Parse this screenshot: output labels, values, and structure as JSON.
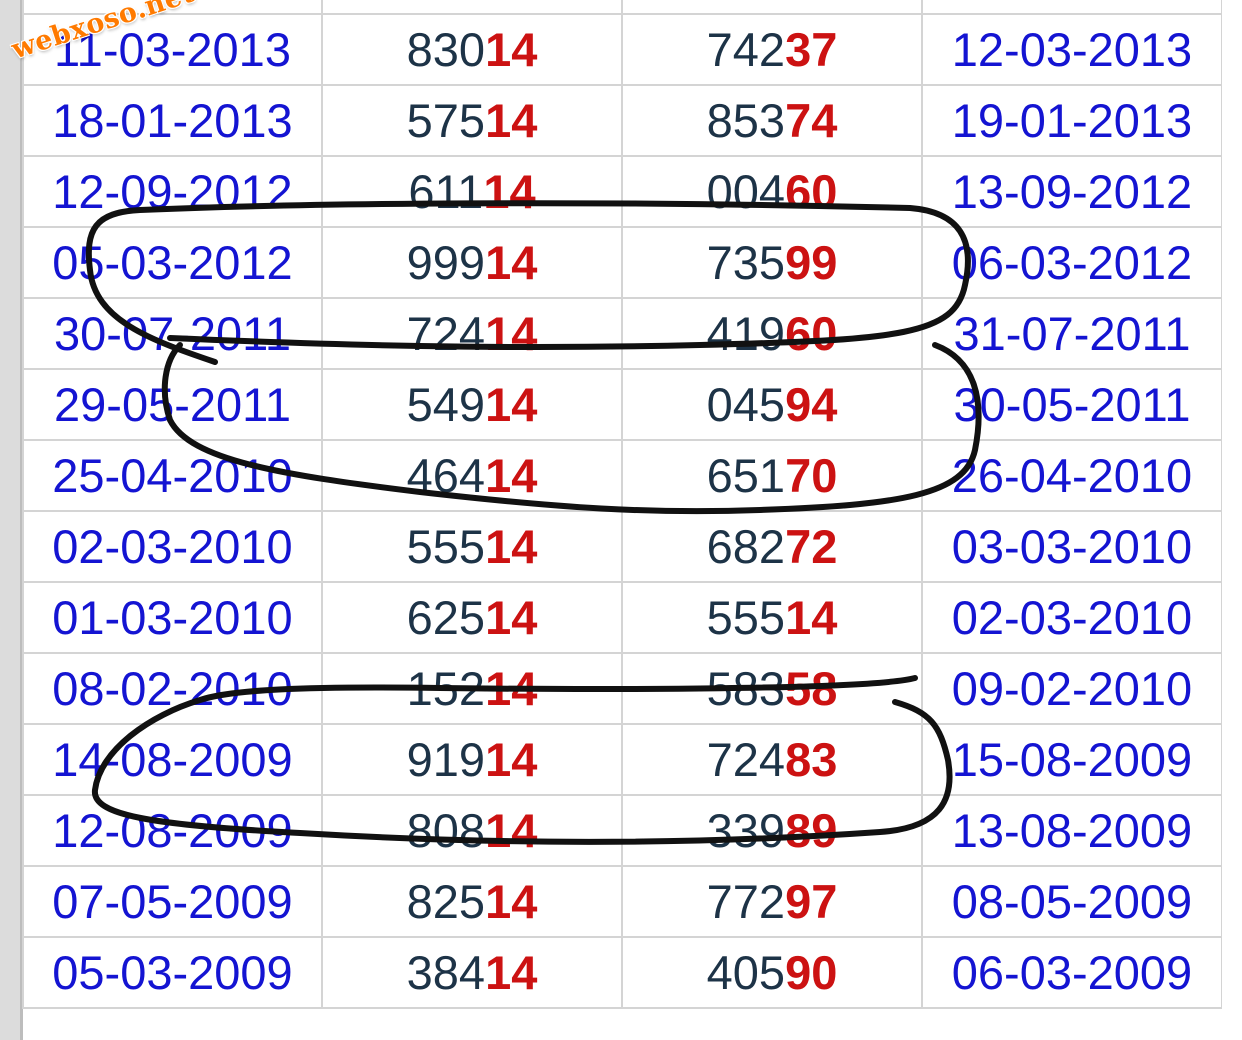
{
  "watermark": "webxoso.net",
  "rows": [
    {
      "date": "11-03-2013",
      "num1_head": "830",
      "num1_tail": "14",
      "num2_head": "742",
      "num2_tail": "37",
      "date2": "12-03-2013"
    },
    {
      "date": "18-01-2013",
      "num1_head": "575",
      "num1_tail": "14",
      "num2_head": "853",
      "num2_tail": "74",
      "date2": "19-01-2013"
    },
    {
      "date": "12-09-2012",
      "num1_head": "611",
      "num1_tail": "14",
      "num2_head": "004",
      "num2_tail": "60",
      "date2": "13-09-2012"
    },
    {
      "date": "05-03-2012",
      "num1_head": "999",
      "num1_tail": "14",
      "num2_head": "735",
      "num2_tail": "99",
      "date2": "06-03-2012"
    },
    {
      "date": "30-07-2011",
      "num1_head": "724",
      "num1_tail": "14",
      "num2_head": "419",
      "num2_tail": "60",
      "date2": "31-07-2011"
    },
    {
      "date": "29-05-2011",
      "num1_head": "549",
      "num1_tail": "14",
      "num2_head": "045",
      "num2_tail": "94",
      "date2": "30-05-2011"
    },
    {
      "date": "25-04-2010",
      "num1_head": "464",
      "num1_tail": "14",
      "num2_head": "651",
      "num2_tail": "70",
      "date2": "26-04-2010"
    },
    {
      "date": "02-03-2010",
      "num1_head": "555",
      "num1_tail": "14",
      "num2_head": "682",
      "num2_tail": "72",
      "date2": "03-03-2010"
    },
    {
      "date": "01-03-2010",
      "num1_head": "625",
      "num1_tail": "14",
      "num2_head": "555",
      "num2_tail": "14",
      "date2": "02-03-2010"
    },
    {
      "date": "08-02-2010",
      "num1_head": "152",
      "num1_tail": "14",
      "num2_head": "583",
      "num2_tail": "58",
      "date2": "09-02-2010"
    },
    {
      "date": "14-08-2009",
      "num1_head": "919",
      "num1_tail": "14",
      "num2_head": "724",
      "num2_tail": "83",
      "date2": "15-08-2009"
    },
    {
      "date": "12-08-2009",
      "num1_head": "808",
      "num1_tail": "14",
      "num2_head": "339",
      "num2_tail": "89",
      "date2": "13-08-2009"
    },
    {
      "date": "07-05-2009",
      "num1_head": "825",
      "num1_tail": "14",
      "num2_head": "772",
      "num2_tail": "97",
      "date2": "08-05-2009"
    },
    {
      "date": "05-03-2009",
      "num1_head": "384",
      "num1_tail": "14",
      "num2_head": "405",
      "num2_tail": "90",
      "date2": "06-03-2009"
    }
  ],
  "colors": {
    "date": "#1414d2",
    "number": "#1d3347",
    "tail": "#cc1212",
    "grid": "#d4d4d4",
    "watermark": "#ff7a00",
    "annotation": "#111111"
  }
}
